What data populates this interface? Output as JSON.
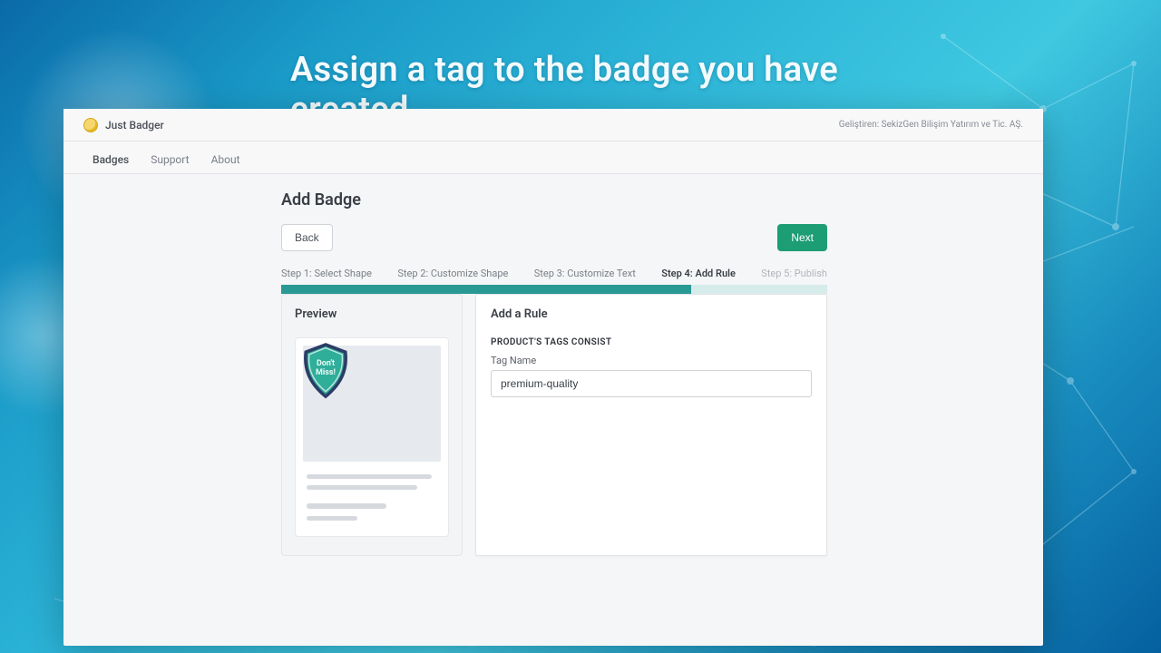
{
  "headline": "Assign a tag to the badge you have created",
  "app": {
    "brand": "Just Badger",
    "developer_label": "Geliştiren: SekizGen Bilişim Yatırım ve Tic. AŞ."
  },
  "tabs": {
    "badges": "Badges",
    "support": "Support",
    "about": "About"
  },
  "page": {
    "title": "Add Badge",
    "back_label": "Back",
    "next_label": "Next"
  },
  "steps": {
    "s1": "Step 1: Select Shape",
    "s2": "Step 2: Customize Shape",
    "s3": "Step 3: Customize Text",
    "s4": "Step 4: Add Rule",
    "s5": "Step 5: Publish",
    "progress_percent": 75
  },
  "preview": {
    "title": "Preview",
    "badge_line1": "Don't",
    "badge_line2": "Miss!"
  },
  "rule": {
    "title": "Add a Rule",
    "section_label": "PRODUCT'S TAGS CONSIST",
    "field_label": "Tag Name",
    "tag_value": "premium-quality"
  },
  "colors": {
    "accent_green": "#1d9d74",
    "stepper_teal": "#289a93",
    "badge_fill": "#2fae9a",
    "badge_stroke": "#2b3d66"
  }
}
